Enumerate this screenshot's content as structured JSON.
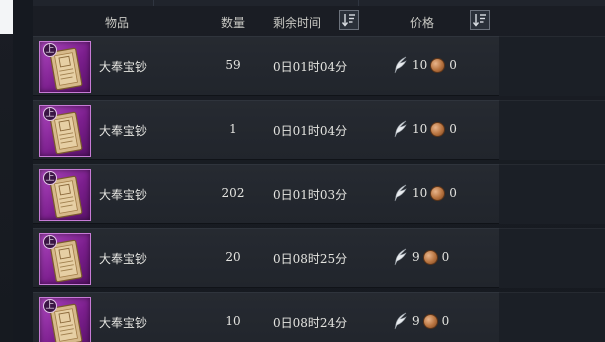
{
  "columns": {
    "item": "物品",
    "quantity": "数量",
    "time_left": "剩余时间",
    "price": "价格"
  },
  "icons": {
    "sort": "sort-descending-icon",
    "item": "scroll-icon",
    "grade": "grade-badge-icon",
    "currency_main": "feather-currency-icon",
    "currency_sub": "copper-coin-icon"
  },
  "colors": {
    "item_frame": "#9a34ad",
    "text": "#e4e4e0",
    "header_text": "#c9c9c4"
  },
  "listings": [
    {
      "grade": "上",
      "name": "大奉宝钞",
      "quantity": "59",
      "time_left": "0日01时04分",
      "price_main": "10",
      "price_sub": "0"
    },
    {
      "grade": "上",
      "name": "大奉宝钞",
      "quantity": "1",
      "time_left": "0日01时04分",
      "price_main": "10",
      "price_sub": "0"
    },
    {
      "grade": "上",
      "name": "大奉宝钞",
      "quantity": "202",
      "time_left": "0日01时03分",
      "price_main": "10",
      "price_sub": "0"
    },
    {
      "grade": "上",
      "name": "大奉宝钞",
      "quantity": "20",
      "time_left": "0日08时25分",
      "price_main": "9",
      "price_sub": "0"
    },
    {
      "grade": "上",
      "name": "大奉宝钞",
      "quantity": "10",
      "time_left": "0日08时24分",
      "price_main": "9",
      "price_sub": "0"
    }
  ]
}
